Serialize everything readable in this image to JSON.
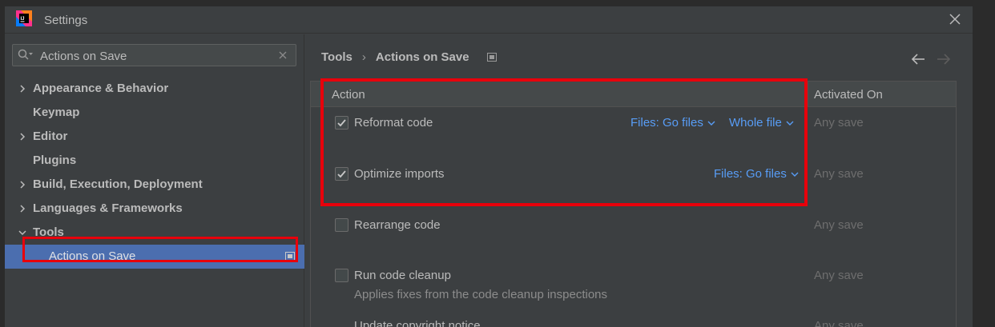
{
  "window": {
    "title": "Settings",
    "logo_text": "IJ"
  },
  "search": {
    "value": "Actions on Save",
    "placeholder": ""
  },
  "tree": [
    {
      "label": "Appearance & Behavior",
      "expandable": true,
      "expanded": false
    },
    {
      "label": "Keymap",
      "expandable": false
    },
    {
      "label": "Editor",
      "expandable": true,
      "expanded": false
    },
    {
      "label": "Plugins",
      "expandable": false
    },
    {
      "label": "Build, Execution, Deployment",
      "expandable": true,
      "expanded": false
    },
    {
      "label": "Languages & Frameworks",
      "expandable": true,
      "expanded": false
    },
    {
      "label": "Tools",
      "expandable": true,
      "expanded": true
    },
    {
      "label": "Actions on Save",
      "selected": true
    }
  ],
  "breadcrumb": {
    "parent": "Tools",
    "separator": "›",
    "current": "Actions on Save"
  },
  "table": {
    "col_action": "Action",
    "col_activated": "Activated On",
    "rows": [
      {
        "label": "Reformat code",
        "checked": true,
        "link1": "Files: Go files",
        "link2": "Whole file",
        "activated": "Any save"
      },
      {
        "label": "Optimize imports",
        "checked": true,
        "link1": "Files: Go files",
        "activated": "Any save"
      },
      {
        "label": "Rearrange code",
        "checked": false,
        "activated": "Any save"
      },
      {
        "label": "Run code cleanup",
        "checked": false,
        "sub": "Applies fixes from the code cleanup inspections",
        "activated": "Any save"
      },
      {
        "label": "Update copyright notice",
        "checked": false,
        "activated": "Any save"
      }
    ]
  },
  "colors": {
    "accent": "#4b6eaf",
    "link": "#589df6",
    "highlight": "#e8000b"
  }
}
